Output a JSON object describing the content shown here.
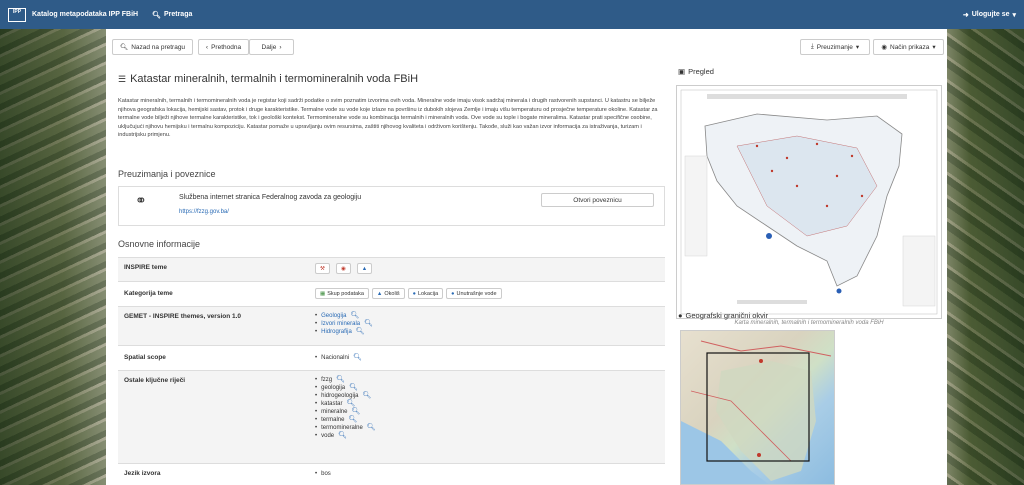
{
  "navbar": {
    "logo_text": "IPP",
    "title": "Katalog metapodataka IPP FBiH",
    "search_label": "Pretraga",
    "login_label": "Ulogujte se"
  },
  "toolbar": {
    "back_label": "Nazad na pretragu",
    "prev_label": "Prethodna",
    "next_label": "Dalje",
    "download_label": "Preuzimanje",
    "view_label": "Način prikaza"
  },
  "record": {
    "title": "Katastar mineralnih, termalnih i termomineralnih voda FBiH",
    "description": "Katastar mineralnih, termalnih i termomineralnih voda je registar koji sadrži podatke o svim poznatim izvorima ovih voda. Mineralne vode imaju visok sadržaj minerala i drugih rastvorenih supstanci. U katastru se bilježe njihova geografska lokacija, hemijski sastav, protok i druge karakteristike. Termalne vode su vode koje izlaze na površinu iz dubokih slojeva Zemlje i imaju višu temperaturu od prosječne temperature okoline. Katastar za termalne vode bilježi njihove termalne karakteristike, tok i geološki kontekst. Termomineralne vode su kombinacija termalnih i mineralnih voda. Ove vode su tople i bogate mineralima. Katastar prati specifične osobine, uključujući njihovu hemijsku i termalnu kompoziciju. Katastar pomaže u upravljanju ovim resursima, zaštiti njihovog kvaliteta i održivom korištenju. Takođe, služi kao važan izvor informacija za istraživanja, turizam i industrijsku primjenu."
  },
  "links_section": {
    "heading": "Preuzimanja i poveznice",
    "link_title": "Službena internet stranica Federalnog zavoda za geologiju",
    "link_url": "https://fzzg.gov.ba/",
    "open_button": "Otvori poveznicu"
  },
  "info_section": {
    "heading": "Osnovne informacije",
    "inspire_label": "INSPIRE teme",
    "category_label": "Kategorija teme",
    "categories": [
      "Skup podataka",
      "Okoliš",
      "Lokacija",
      "Unutrašnje vode"
    ],
    "gemet_label": "GEMET - INSPIRE themes, version 1.0",
    "gemet_items": [
      "Geologija",
      "Izvori minerala",
      "Hidrografija"
    ],
    "scope_label": "Spatial scope",
    "scope_items": [
      "Nacionalni"
    ],
    "keywords_label": "Ostale ključne riječi",
    "keywords": [
      "fzzg",
      "geologija",
      "hidrogeologija",
      "katastar",
      "mineralne",
      "termalne",
      "termomineralne",
      "vode"
    ],
    "language_label": "Jezik izvora",
    "language_items": [
      "bos"
    ]
  },
  "sidebar": {
    "preview_label": "Pregled",
    "preview_caption": "Karta mineralnih, termalnih i termomineralnih voda FBiH",
    "bbox_label": "Geografski granični okvir"
  }
}
